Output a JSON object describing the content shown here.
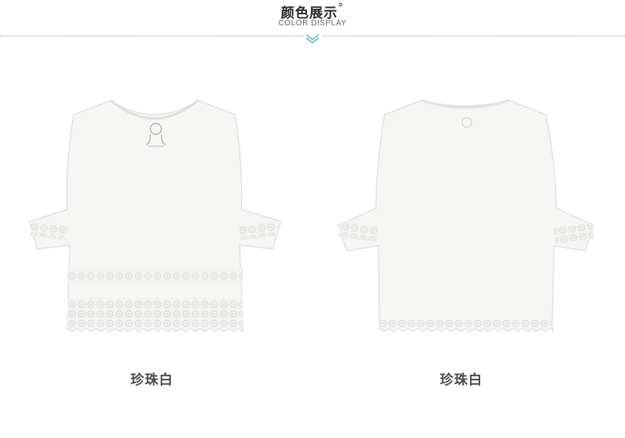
{
  "header": {
    "title": "颜色展示",
    "title_mark": "°",
    "subtitle": "COLOR DISPLAY"
  },
  "products": [
    {
      "label": "珍珠白",
      "view": "front",
      "image": "white-blouse-front"
    },
    {
      "label": "珍珠白",
      "view": "back",
      "image": "white-blouse-back"
    }
  ],
  "colors": {
    "accent": "#5fb8b0",
    "garment": "#f6f6f4"
  }
}
